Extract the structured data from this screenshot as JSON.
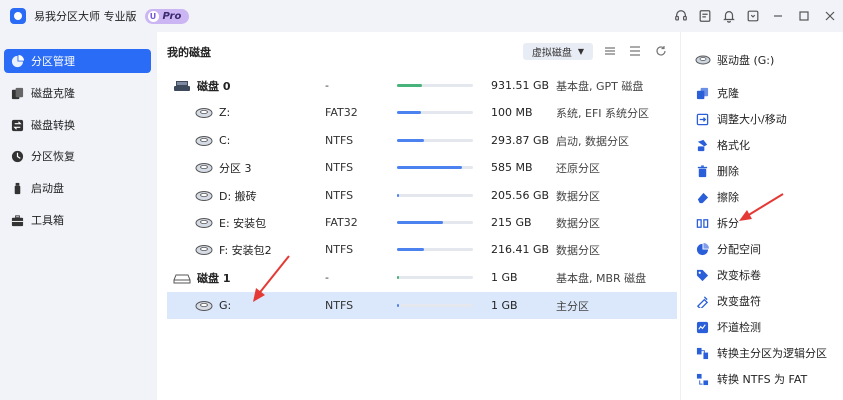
{
  "titlebar": {
    "app_title": "易我分区大师 专业版",
    "pro_label": "Pro",
    "pro_u": "U"
  },
  "sidebar": {
    "items": [
      {
        "label": "分区管理",
        "icon": "pie-chart-icon",
        "active": true
      },
      {
        "label": "磁盘克隆",
        "icon": "clone-icon",
        "active": false
      },
      {
        "label": "磁盘转换",
        "icon": "convert-icon",
        "active": false
      },
      {
        "label": "分区恢复",
        "icon": "recovery-icon",
        "active": false
      },
      {
        "label": "启动盘",
        "icon": "usb-icon",
        "active": false
      },
      {
        "label": "工具箱",
        "icon": "toolbox-icon",
        "active": false
      }
    ]
  },
  "main": {
    "title": "我的磁盘",
    "virtual_disk_label": "虚拟磁盘",
    "rows": [
      {
        "name": "磁盘 0",
        "fs": "-",
        "usage": 0.33,
        "size": "931.51 GB",
        "type": "基本盘, GPT 磁盘",
        "kind": "disk",
        "selected": false
      },
      {
        "name": "Z:",
        "fs": "FAT32",
        "usage": 0.32,
        "size": "100 MB",
        "type": "系统, EFI 系统分区",
        "kind": "part",
        "selected": false
      },
      {
        "name": "C:",
        "fs": "NTFS",
        "usage": 0.36,
        "size": "293.87 GB",
        "type": "启动, 数据分区",
        "kind": "part",
        "selected": false
      },
      {
        "name": "分区 3",
        "fs": "NTFS",
        "usage": 0.85,
        "size": "585 MB",
        "type": "还原分区",
        "kind": "part",
        "selected": false
      },
      {
        "name": "D: 搬砖",
        "fs": "NTFS",
        "usage": 0.03,
        "size": "205.56 GB",
        "type": "数据分区",
        "kind": "part",
        "selected": false
      },
      {
        "name": "E: 安装包",
        "fs": "FAT32",
        "usage": 0.6,
        "size": "215 GB",
        "type": "数据分区",
        "kind": "part",
        "selected": false
      },
      {
        "name": "F: 安装包2",
        "fs": "NTFS",
        "usage": 0.35,
        "size": "216.41 GB",
        "type": "数据分区",
        "kind": "part",
        "selected": false
      },
      {
        "name": "磁盘 1",
        "fs": "-",
        "usage": 0.02,
        "size": "1 GB",
        "type": "基本盘, MBR 磁盘",
        "kind": "disk",
        "selected": false
      },
      {
        "name": "G:",
        "fs": "NTFS",
        "usage": 0.01,
        "size": "1 GB",
        "type": "主分区",
        "kind": "part",
        "selected": true
      }
    ]
  },
  "rpanel": {
    "title": "驱动盘 (G:)",
    "actions": [
      {
        "label": "克隆",
        "icon": "clone-icon"
      },
      {
        "label": "调整大小/移动",
        "icon": "resize-icon"
      },
      {
        "label": "格式化",
        "icon": "format-icon"
      },
      {
        "label": "删除",
        "icon": "trash-icon"
      },
      {
        "label": "擦除",
        "icon": "eraser-icon"
      },
      {
        "label": "拆分",
        "icon": "split-icon"
      },
      {
        "label": "分配空间",
        "icon": "allocate-icon"
      },
      {
        "label": "改变标卷",
        "icon": "label-icon"
      },
      {
        "label": "改变盘符",
        "icon": "drive-letter-icon"
      },
      {
        "label": "坏道检测",
        "icon": "surface-test-icon"
      },
      {
        "label": "转换主分区为逻辑分区",
        "icon": "convert-logical-icon"
      },
      {
        "label": "转换 NTFS 为 FAT",
        "icon": "convert-fat-icon"
      }
    ]
  },
  "colors": {
    "accent": "#2b6cf6",
    "sidebar_bg": "#f1f3f8",
    "selected_row": "#dbe7fb",
    "arrow": "#e53935"
  }
}
